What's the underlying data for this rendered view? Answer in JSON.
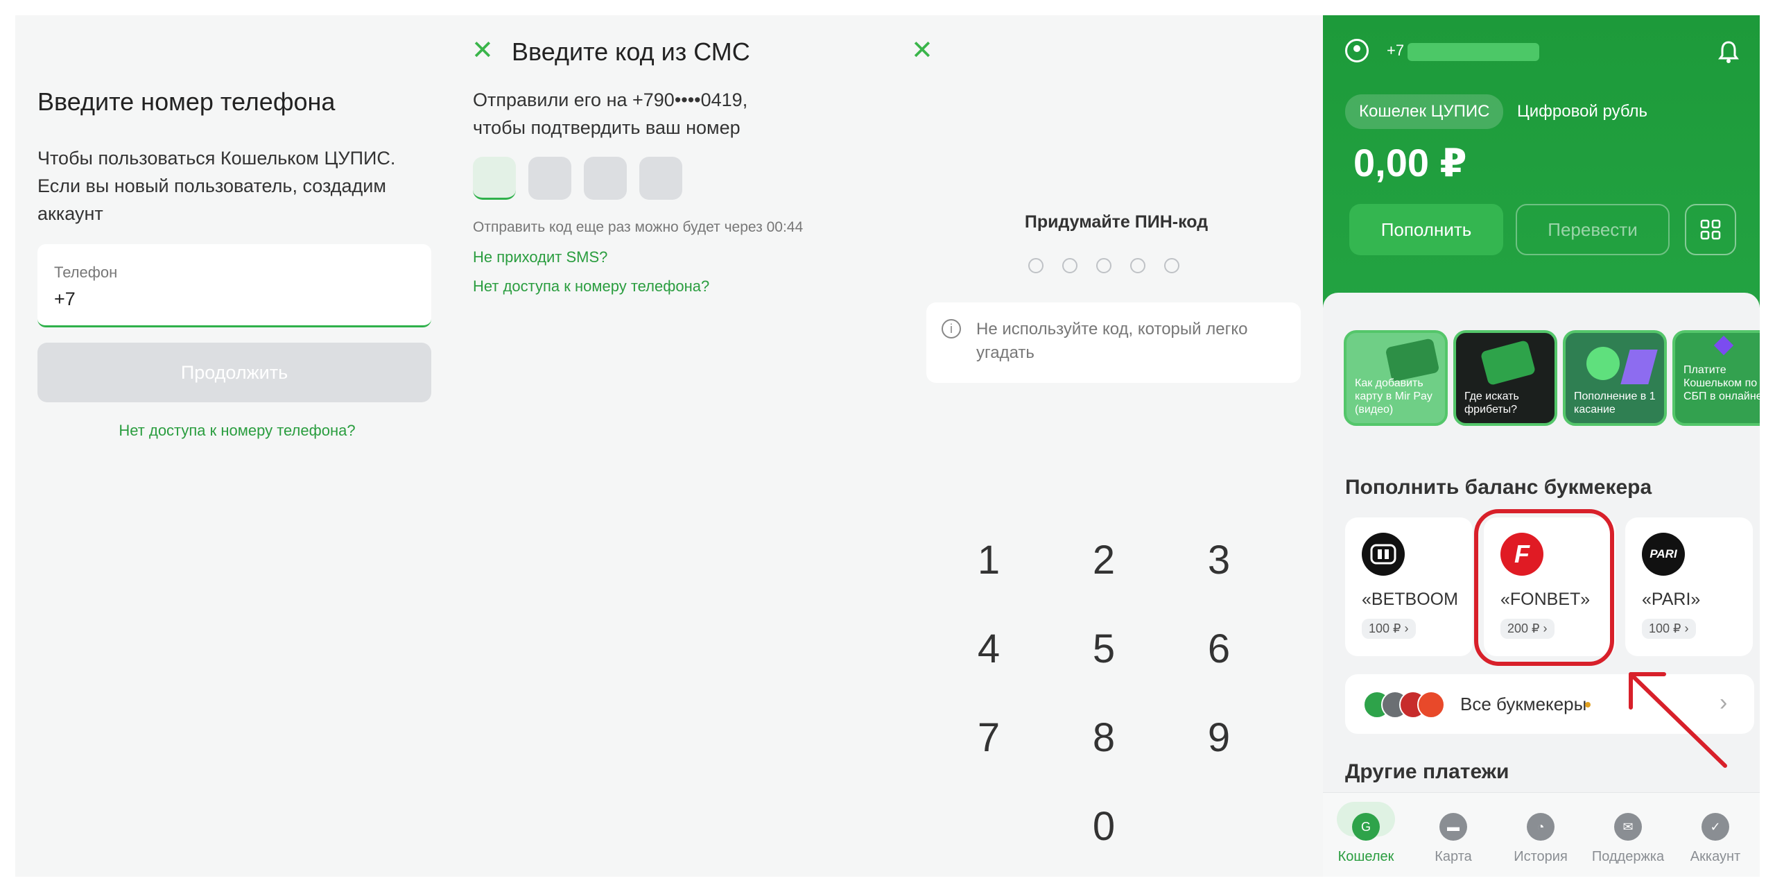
{
  "phone_screen": {
    "title": "Введите номер телефона",
    "description": "Чтобы пользоваться Кошельком ЦУПИС. Если вы новый пользователь, создадим аккаунт",
    "field_label": "Телефон",
    "field_value": "+7",
    "continue_label": "Продолжить",
    "no_access_link": "Нет доступа к номеру телефона?"
  },
  "sms_screen": {
    "title": "Введите код из СМС",
    "sent_line1": "Отправили его на +790••••0419,",
    "sent_line2": "чтобы подтвердить ваш номер",
    "resend_text": "Отправить код еще раз можно будет через 00:44",
    "no_sms_link": "Не приходит SMS?",
    "no_access_link": "Нет доступа к номеру телефона?"
  },
  "pin_screen": {
    "title": "Придумайте ПИН-код",
    "hint": "Не используйте код, который легко угадать",
    "keys": [
      "1",
      "2",
      "3",
      "4",
      "5",
      "6",
      "7",
      "8",
      "9",
      "0"
    ]
  },
  "wallet": {
    "phone_prefix": "+7",
    "tab_active": "Кошелек ЦУПИС",
    "tab_inactive": "Цифровой рубль",
    "balance": "0,00 ₽",
    "topup_label": "Пополнить",
    "transfer_label": "Перевести",
    "stories": [
      {
        "label": "Как добавить карту в Mir Pay (видео)"
      },
      {
        "label": "Где искать фрибеты?"
      },
      {
        "label": "Пополнение в 1 касание"
      },
      {
        "label": "Платите Кошельком по СБП в онлайне"
      }
    ],
    "bookmakers_title": "Пополнить баланс букмекера",
    "bookmakers": [
      {
        "name": "«BETBOOM",
        "price": "100 ₽"
      },
      {
        "name": "«FONBET»",
        "price": "200 ₽"
      },
      {
        "name": "«PARI»",
        "price": "100 ₽"
      }
    ],
    "all_bookmakers": "Все букмекеры",
    "other_payments": "Другие платежи",
    "nav": [
      "Кошелек",
      "Карта",
      "История",
      "Поддержка",
      "Аккаунт"
    ],
    "colors": {
      "brand_green": "#1d9a3a",
      "highlight_red": "#d8202a"
    }
  }
}
